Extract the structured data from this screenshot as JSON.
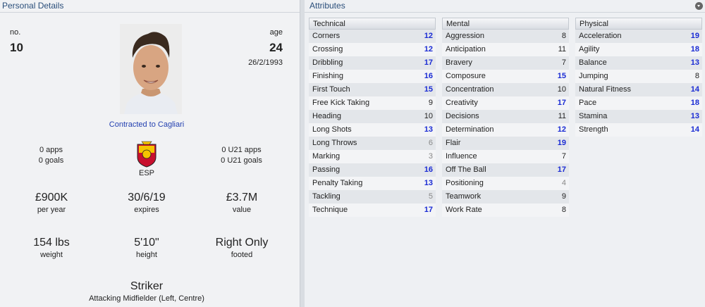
{
  "personal": {
    "title": "Personal Details",
    "no_label": "no.",
    "no_value": "10",
    "age_label": "age",
    "age_value": "24",
    "dob": "26/2/1993",
    "contract": "Contracted to Cagliari",
    "apps": "0 apps",
    "goals": "0 goals",
    "u21_apps": "0 U21 apps",
    "u21_goals": "0 U21 goals",
    "nation": "ESP",
    "wage_value": "£900K",
    "wage_label": "per year",
    "expires_value": "30/6/19",
    "expires_label": "expires",
    "value_value": "£3.7M",
    "value_label": "value",
    "weight_value": "154 lbs",
    "weight_label": "weight",
    "height_value": "5'10\"",
    "height_label": "height",
    "foot_value": "Right Only",
    "foot_label": "footed",
    "position_main": "Striker",
    "position_sub": "Attacking Midfielder (Left, Centre)"
  },
  "attributes": {
    "title": "Attributes",
    "technical": {
      "header": "Technical",
      "rows": [
        {
          "name": "Corners",
          "value": "12"
        },
        {
          "name": "Crossing",
          "value": "12"
        },
        {
          "name": "Dribbling",
          "value": "17"
        },
        {
          "name": "Finishing",
          "value": "16"
        },
        {
          "name": "First Touch",
          "value": "15"
        },
        {
          "name": "Free Kick Taking",
          "value": "9"
        },
        {
          "name": "Heading",
          "value": "10"
        },
        {
          "name": "Long Shots",
          "value": "13"
        },
        {
          "name": "Long Throws",
          "value": "6"
        },
        {
          "name": "Marking",
          "value": "3"
        },
        {
          "name": "Passing",
          "value": "16"
        },
        {
          "name": "Penalty Taking",
          "value": "13"
        },
        {
          "name": "Tackling",
          "value": "5"
        },
        {
          "name": "Technique",
          "value": "17"
        }
      ]
    },
    "mental": {
      "header": "Mental",
      "rows": [
        {
          "name": "Aggression",
          "value": "8"
        },
        {
          "name": "Anticipation",
          "value": "11"
        },
        {
          "name": "Bravery",
          "value": "7"
        },
        {
          "name": "Composure",
          "value": "15"
        },
        {
          "name": "Concentration",
          "value": "10"
        },
        {
          "name": "Creativity",
          "value": "17"
        },
        {
          "name": "Decisions",
          "value": "11"
        },
        {
          "name": "Determination",
          "value": "12"
        },
        {
          "name": "Flair",
          "value": "19"
        },
        {
          "name": "Influence",
          "value": "7"
        },
        {
          "name": "Off The Ball",
          "value": "17"
        },
        {
          "name": "Positioning",
          "value": "4"
        },
        {
          "name": "Teamwork",
          "value": "9"
        },
        {
          "name": "Work Rate",
          "value": "8"
        }
      ]
    },
    "physical": {
      "header": "Physical",
      "rows": [
        {
          "name": "Acceleration",
          "value": "19"
        },
        {
          "name": "Agility",
          "value": "18"
        },
        {
          "name": "Balance",
          "value": "13"
        },
        {
          "name": "Jumping",
          "value": "8"
        },
        {
          "name": "Natural Fitness",
          "value": "14"
        },
        {
          "name": "Pace",
          "value": "18"
        },
        {
          "name": "Stamina",
          "value": "13"
        },
        {
          "name": "Strength",
          "value": "14"
        }
      ]
    }
  },
  "colors": {
    "high": "#1a2bd4",
    "mid": "#222222",
    "low": "#888888",
    "link": "#2340b0"
  }
}
